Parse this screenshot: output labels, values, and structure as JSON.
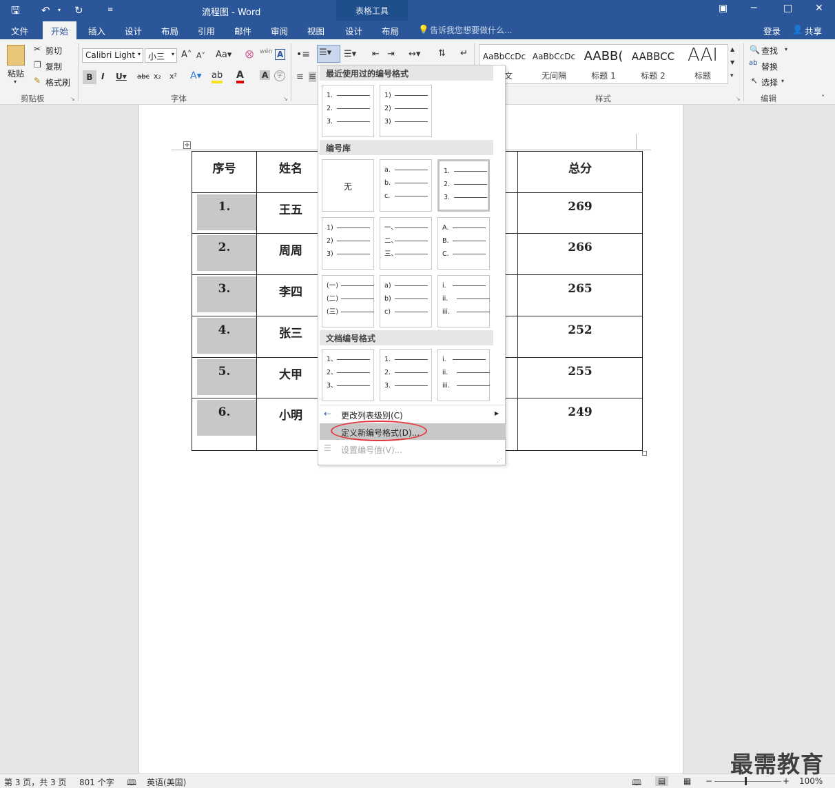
{
  "window": {
    "title": "流程图 - Word",
    "context_tab": "表格工具"
  },
  "tabs": [
    "文件",
    "开始",
    "插入",
    "设计",
    "布局",
    "引用",
    "邮件",
    "审阅",
    "视图",
    "设计",
    "布局"
  ],
  "tell_me": "告诉我您想要做什么...",
  "account": {
    "signin": "登录",
    "share": "共享"
  },
  "clipboard": {
    "paste": "粘贴",
    "cut": "剪切",
    "copy": "复制",
    "format_painter": "格式刷",
    "group": "剪贴板"
  },
  "font": {
    "name": "Calibri Light",
    "size": "小三",
    "group": "字体"
  },
  "styles": {
    "group": "样式",
    "items": [
      {
        "preview": "AaBbCcDc",
        "name": "正文"
      },
      {
        "preview": "AaBbCcDc",
        "name": "无间隔"
      },
      {
        "preview": "AABB(",
        "name": "标题 1"
      },
      {
        "preview": "AABBCC",
        "name": "标题 2"
      },
      {
        "preview": "AAI",
        "name": "标题"
      }
    ]
  },
  "editing": {
    "find": "查找",
    "replace": "替换",
    "select": "选择",
    "group": "编辑"
  },
  "table": {
    "headers": [
      "序号",
      "姓名",
      "总分"
    ],
    "rows": [
      {
        "num": "1.",
        "name": "王五",
        "total": "269"
      },
      {
        "num": "2.",
        "name": "周周",
        "total": "266"
      },
      {
        "num": "3.",
        "name": "李四",
        "total": "265"
      },
      {
        "num": "4.",
        "name": "张三",
        "total": "252"
      },
      {
        "num": "5.",
        "name": "大甲",
        "total": "255"
      },
      {
        "num": "6.",
        "name": "小明",
        "total": "249"
      }
    ]
  },
  "menu": {
    "recent_title": "最近使用过的编号格式",
    "library_title": "编号库",
    "document_title": "文档编号格式",
    "none_label": "无",
    "recent": [
      [
        "1.",
        "2.",
        "3."
      ],
      [
        "1)",
        "2)",
        "3)"
      ]
    ],
    "library": [
      [],
      [
        "a.",
        "b.",
        "c."
      ],
      [
        "1.",
        "2.",
        "3."
      ],
      [
        "1)",
        "2)",
        "3)"
      ],
      [
        "一、",
        "二、",
        "三、"
      ],
      [
        "A.",
        "B.",
        "C."
      ],
      [
        "(一)",
        "(二)",
        "(三)"
      ],
      [
        "a)",
        "b)",
        "c)"
      ],
      [
        "i.",
        "ii.",
        "iii."
      ]
    ],
    "document": [
      [
        "1、",
        "2、",
        "3、"
      ],
      [
        "1.",
        "2.",
        "3."
      ],
      [
        "i.",
        "ii.",
        "iii."
      ]
    ],
    "change_level": "更改列表级别(C)",
    "define_new": "定义新编号格式(D)...",
    "set_value": "设置编号值(V)..."
  },
  "status": {
    "page": "第 3 页，共 3 页",
    "words": "801 个字",
    "language": "英语(美国)",
    "zoom": "100%"
  },
  "watermark": "最需教育"
}
